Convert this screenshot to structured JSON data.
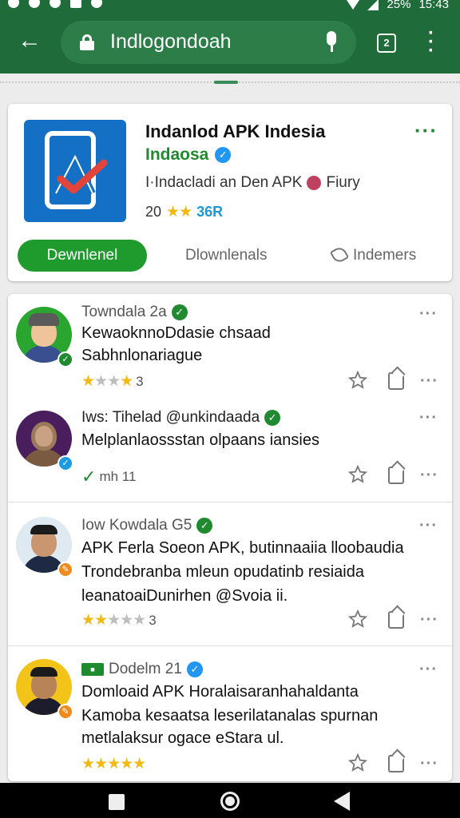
{
  "status_bar": {
    "battery": "25%",
    "time": "15:43"
  },
  "browser": {
    "url": "Indlogondoah",
    "tab_count": "2"
  },
  "app": {
    "title": "Indanlod APK Indesia",
    "developer": "Indaosa",
    "subtitle_left": "I·Indacladi  an Den APK",
    "subtitle_right": "Fiury",
    "stats_prefix": "20",
    "stats_value": "36R",
    "download_label": "Dewnlenel",
    "downloads_label": "Dlownlenals",
    "share_label": "Indemers"
  },
  "reviews": [
    {
      "name": "Towndala 2a",
      "line1": "KewaoknnoDdasie chsaad",
      "line2": "Sabhnlonariague",
      "line3": "",
      "rating_text": "3",
      "rating": 1,
      "verified_color": "green"
    },
    {
      "name": "Iws: Tihelad @unkindaada",
      "line1": "Melplanlaossstan olpaans iansies",
      "line2": "",
      "line3": "",
      "rating_text": "mh  11",
      "rating": 0,
      "verified_color": "green"
    },
    {
      "name": "Iow Kowdala G5",
      "line1": "APK Ferla Soeon APK, butinnaaiia lloobaudia",
      "line2": "Trondebranba mleun opudatinb resiaida",
      "line3": "leanatoaiDunirhen @Svoia ii.",
      "rating_text": "3",
      "rating": 1.5,
      "verified_color": "green"
    },
    {
      "name": "Dodelm 21",
      "line1": "Domloaid APK Horalaisaranhahaldanta",
      "line2": "Kamoba kesaatsa leserilatanalas spurnan",
      "line3": "metlalaksur ogace eStara ul.",
      "rating_text": "",
      "rating": 5,
      "verified_color": "blue"
    }
  ],
  "colors": {
    "toolbar": "#1f6b3a",
    "primary": "#1f9a2c",
    "verified_blue": "#2196f3",
    "star": "#f2b90f"
  }
}
